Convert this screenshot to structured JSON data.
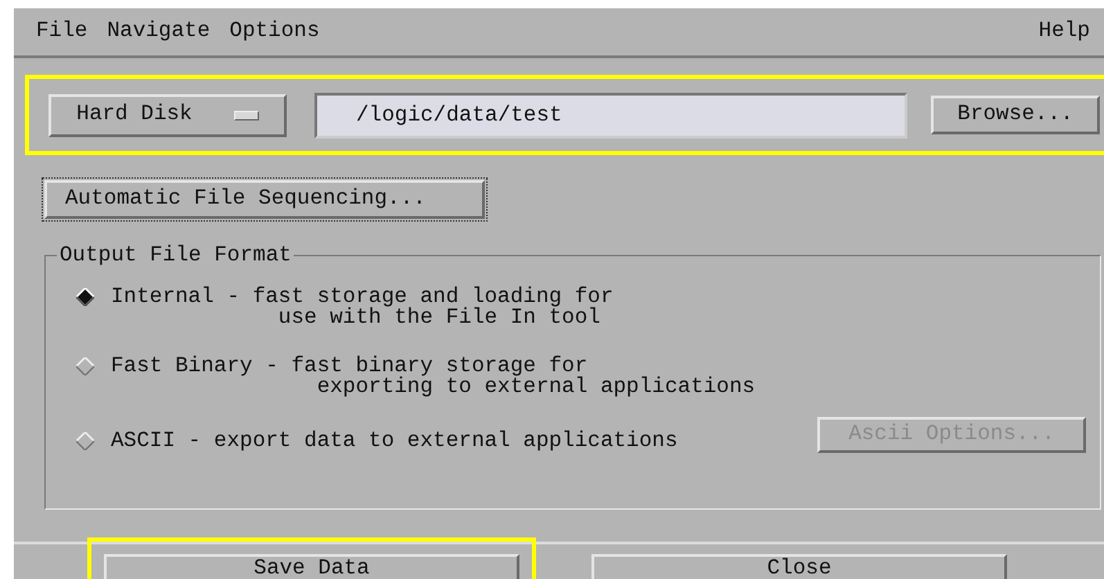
{
  "menu_bar": {
    "left": [
      "File",
      "Navigate",
      "Options"
    ],
    "right": [
      "Help"
    ]
  },
  "location": {
    "highlighted": true,
    "drive": "Hard Disk",
    "path": "/logic/data/test",
    "browse": "Browse..."
  },
  "sequencing_button": "Automatic File Sequencing...",
  "output_format": {
    "title": "Output File Format",
    "options": [
      {
        "label": "Internal - fast storage and loading for\n             use with the File In tool",
        "selected": true
      },
      {
        "label": "Fast Binary - fast binary storage for\n                exporting to external applications",
        "selected": false
      },
      {
        "label": "ASCII - export data to external applications",
        "selected": false,
        "button": {
          "label": "Ascii Options...",
          "disabled": true
        }
      }
    ]
  },
  "footer": [
    {
      "label": "Save Data",
      "highlighted": true
    },
    {
      "label": "Close",
      "highlighted": false
    }
  ]
}
